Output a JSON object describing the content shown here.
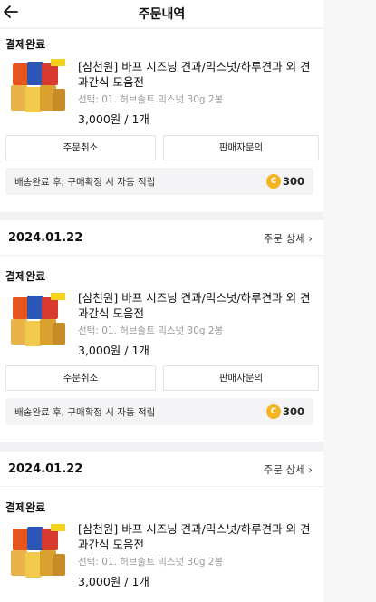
{
  "header": {
    "title": "주문내역"
  },
  "labels": {
    "detail": "주문 상세",
    "cancel": "주문취소",
    "inquiry": "판매자문의",
    "point_text": "배송완료 후, 구매확정 시 자동 적립"
  },
  "colors": {
    "coin": "#f3b522",
    "background": "#f1f1f3"
  },
  "orders": [
    {
      "date": "",
      "status": "결제완료",
      "product": "[삼천원] 바프 시즈닝 견과/믹스넛/하루견과 외 견과간식 모음전",
      "option": "선택: 01. 허브솔트 믹스넛 30g 2봉",
      "price": "3,000원 / 1개",
      "points": "300"
    },
    {
      "date": "2024.01.22",
      "status": "결제완료",
      "product": "[삼천원] 바프 시즈닝 견과/믹스넛/하루견과 외 견과간식 모음전",
      "option": "선택: 01. 허브솔트 믹스넛 30g 2봉",
      "price": "3,000원 / 1개",
      "points": "300"
    },
    {
      "date": "2024.01.22",
      "status": "결제완료",
      "product": "[삼천원] 바프 시즈닝 견과/믹스넛/하루견과 외 견과간식 모음전",
      "option": "선택: 01. 허브솔트 믹스넛 30g 2봉",
      "price": "3,000원 / 1개",
      "points": ""
    }
  ]
}
